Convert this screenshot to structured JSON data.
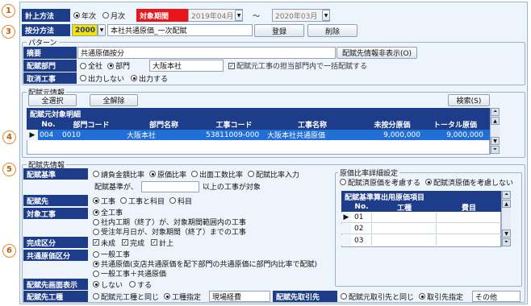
{
  "markers": [
    "1",
    "2",
    "3",
    "4",
    "5",
    "6"
  ],
  "row1": {
    "label": "計上方法",
    "opt_year": "年次",
    "opt_month": "月次",
    "period_label": "対象期間",
    "from": "2019年04月",
    "tilde": "～",
    "to": "2020年03月"
  },
  "row2": {
    "label": "按分方法",
    "code": "2000",
    "name": "本社共通原価_一次配賦",
    "register": "登録",
    "delete": "削除"
  },
  "pattern": {
    "title": "パターン",
    "summary_label": "摘要",
    "summary_value": "共通原価按分",
    "toggle_btn": "配賦先情報非表示(O)",
    "dept_label": "配賦部門",
    "opt_all": "全社",
    "opt_dept": "部門",
    "dept_value": "大阪本社",
    "dept_check": "配賦元工事の担当部門内で一括配賦する",
    "cancel_label": "取消工事",
    "opt_no_out": "出力しない",
    "opt_out": "出力する"
  },
  "source": {
    "title": "配賦元情報",
    "select_all": "全選択",
    "clear_all": "全解除",
    "search": "検索(S)",
    "grid_title": "配賦元対象明細",
    "columns": [
      "No.",
      "部門コード",
      "部門名称",
      "工事コード",
      "工事名称",
      "未按分原価",
      "トータル原価"
    ],
    "rows": [
      {
        "no": "004",
        "dept_code": "0010",
        "dept_name": "大阪本社",
        "job_code": "53811009-000",
        "job_name": "大阪本社共通原価",
        "unalloc": "9,000,000",
        "total": "9,000,000"
      }
    ]
  },
  "dest": {
    "title": "配賦先情報",
    "basis_label": "配賦基準",
    "basis_opts": [
      "請負金額比率",
      "原価比率",
      "出面工数比率",
      "配賦比率入力"
    ],
    "basis_note_prefix": "配賦基準が、",
    "basis_note_suffix": "以上の工事が対象",
    "target_label": "配賦先",
    "target_opts": [
      "工事",
      "工事と科目",
      "科目"
    ],
    "job_label": "対象工事",
    "job_opts": [
      "全工事",
      "社内工期（終了）が、対象期間範囲内の工事",
      "受注年月日が、対象期間（終了）までの工事"
    ],
    "complete_label": "完成区分",
    "complete_opts": [
      "未成",
      "完成",
      "計上"
    ],
    "common_label": "共通原価区分",
    "common_opts": [
      "一般工事",
      "共通原価(支店共通原価を配下部門の共通原価に部門内比率で配賦)",
      "一般工事＋共通原価"
    ],
    "display_label": "配賦先画面表示",
    "display_opts": [
      "しない",
      "する"
    ],
    "detail_title": "原価比率詳細設定",
    "detail_opts": [
      "配賦済原価を考慮する",
      "配賦済原価を考慮しない"
    ],
    "basis_grid_title": "配賦基準算出用原価項目",
    "basis_grid_cols": [
      "No.",
      "工種",
      "費目"
    ],
    "basis_grid_rows": [
      "01",
      "02",
      "03"
    ],
    "job_type_label": "配賦先工種",
    "job_type_opts": [
      "配賦元工種と同じ",
      "工種指定"
    ],
    "job_type_value": "現場経費",
    "client_label": "配賦先取引先",
    "client_opts": [
      "配賦元取引先と同じ",
      "取引先指定"
    ],
    "client_value": "その他"
  },
  "colors": {
    "navy": "#1d3c8a",
    "selection": "#1f6fd6",
    "red": "#e8151b",
    "marker": "#e08a2a"
  }
}
